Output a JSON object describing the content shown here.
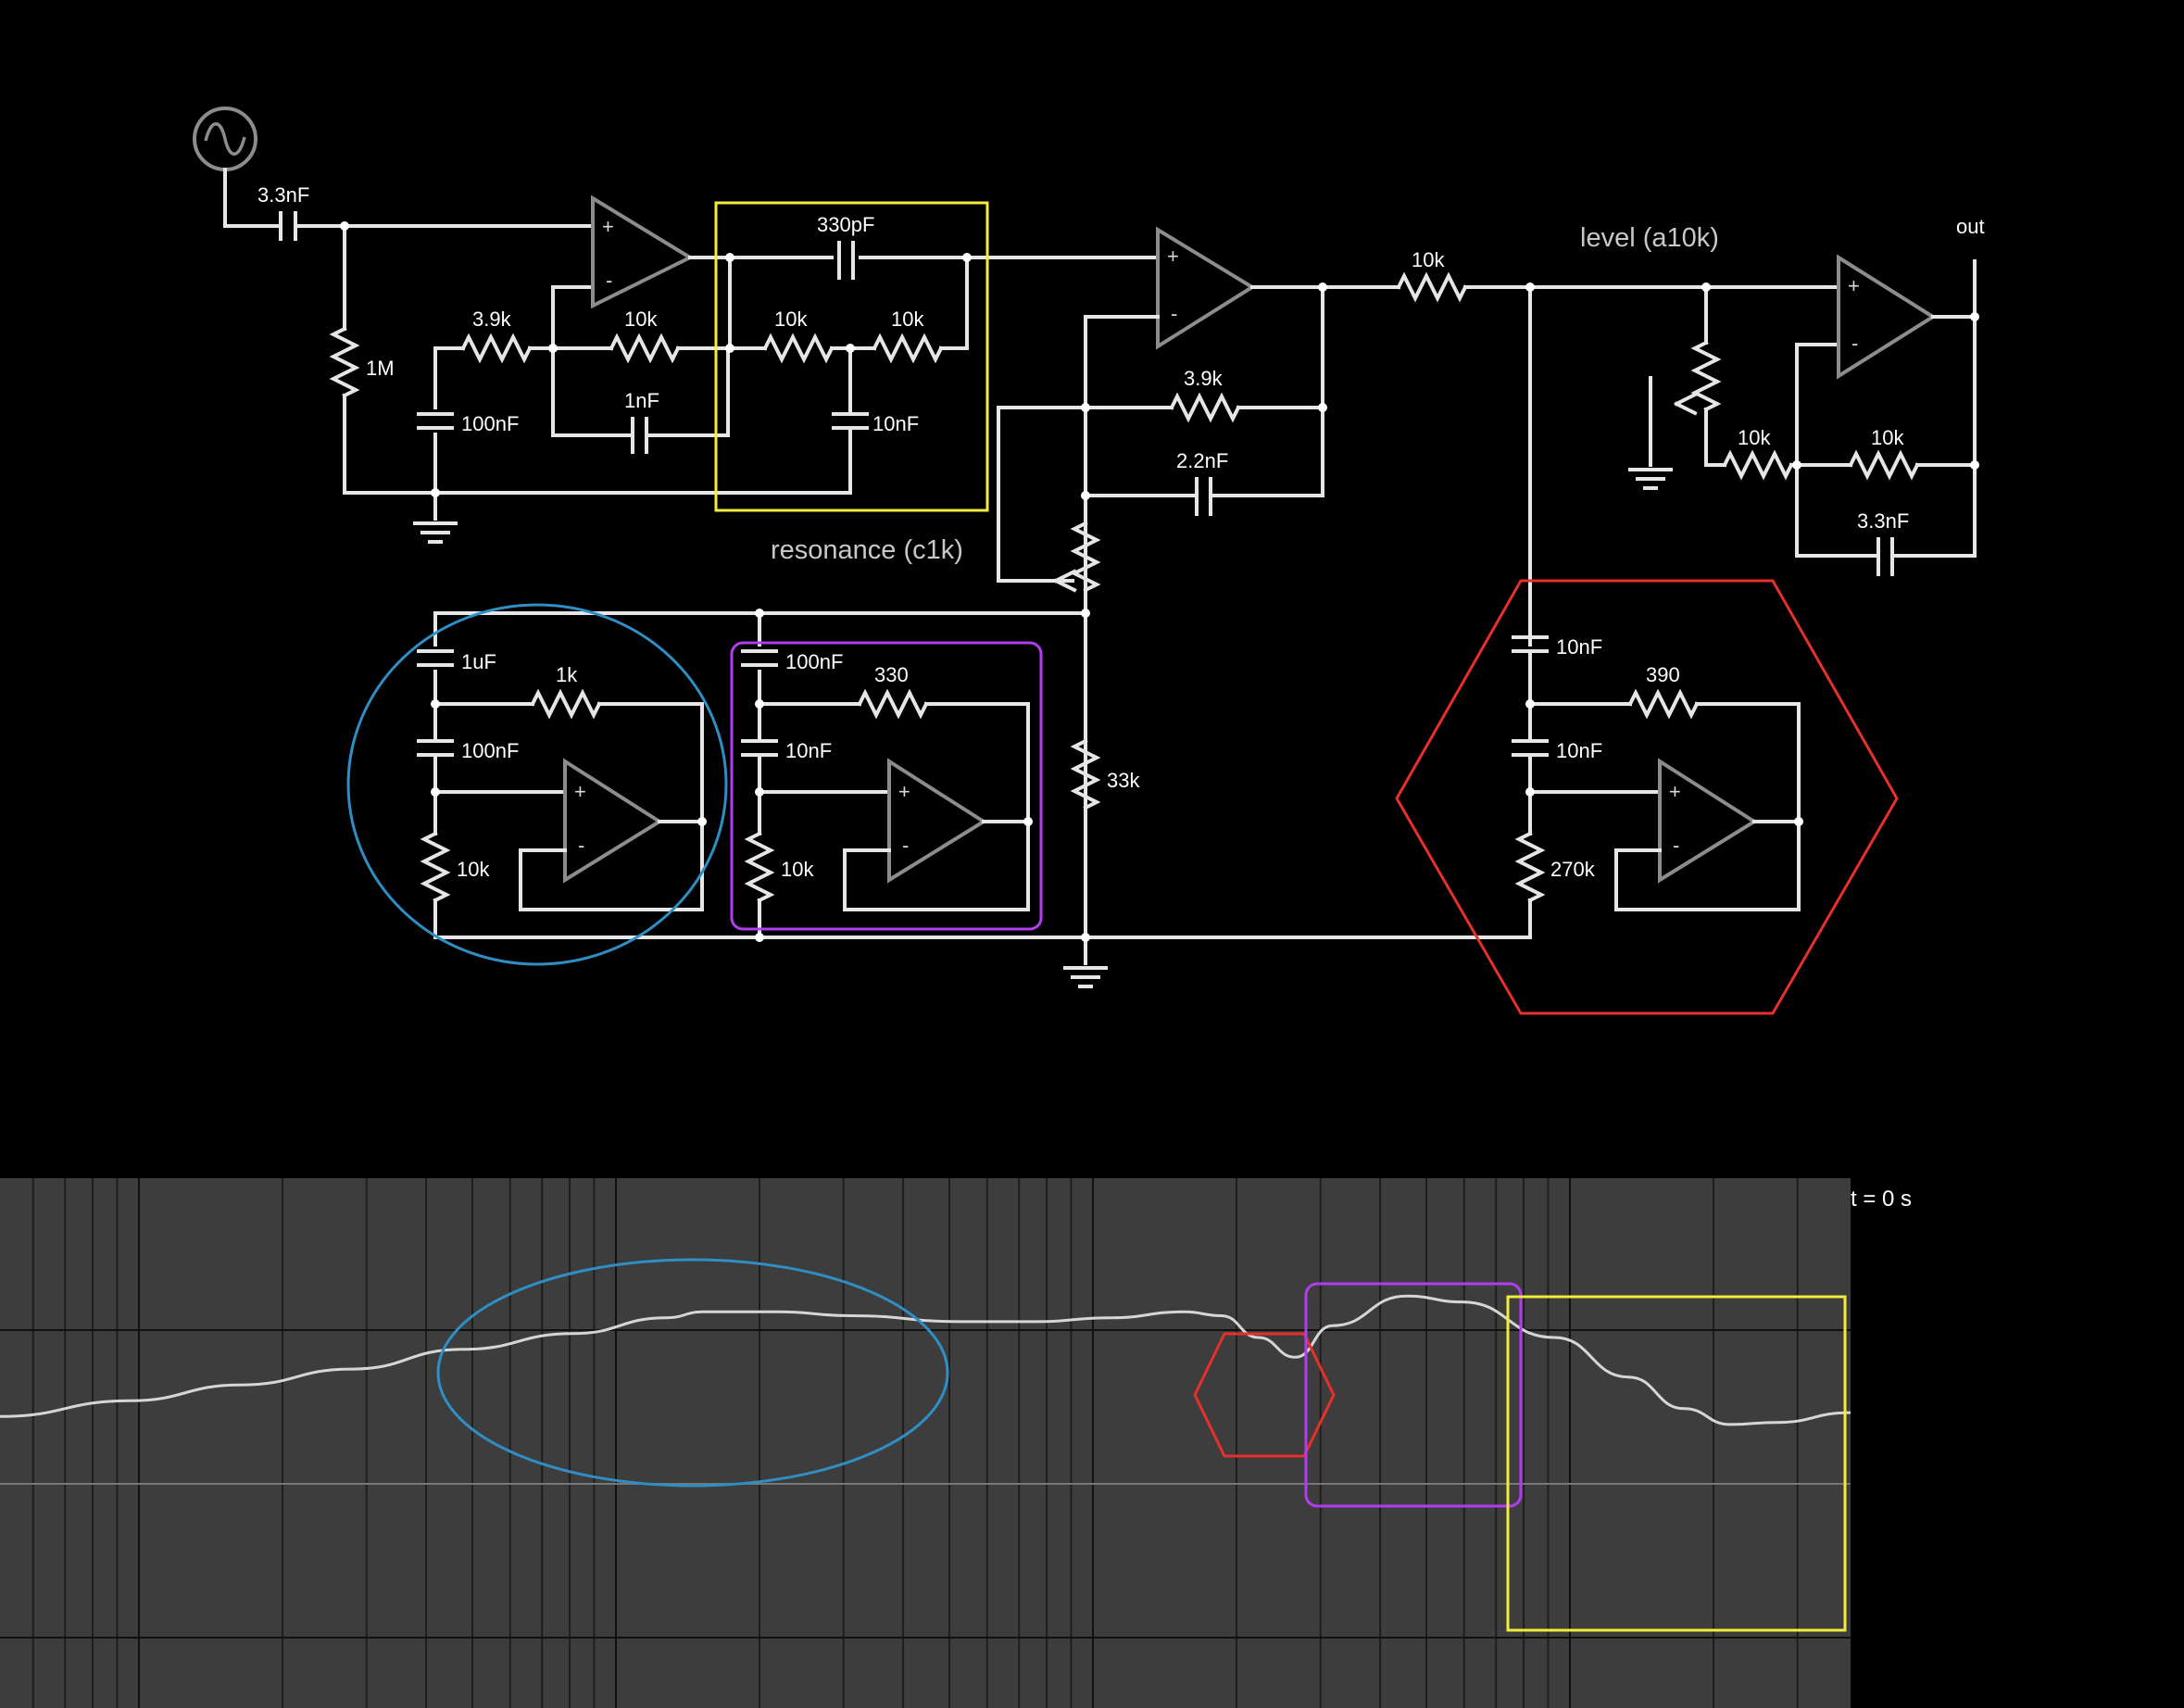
{
  "labels": {
    "c_in": "3.3nF",
    "r_1m": "1M",
    "r_3k9_a": "3.9k",
    "r_10k_a": "10k",
    "c_100nf_a": "100nF",
    "c_1nf": "1nF",
    "c_330pf": "330pF",
    "r_10k_b": "10k",
    "r_10k_c": "10k",
    "c_10nf_a": "10nF",
    "r_3k9_b": "3.9k",
    "c_2n2": "2.2nF",
    "resonance": "resonance (c1k)",
    "r_33k": "33k",
    "r_10k_out": "10k",
    "level": "level (a10k)",
    "out": "out",
    "r_10k_d": "10k",
    "r_10k_e": "10k",
    "c_3n3_b": "3.3nF",
    "c_1uf": "1uF",
    "r_1k": "1k",
    "c_100nf_b": "100nF",
    "r_10k_f": "10k",
    "c_100nf_c": "100nF",
    "r_330": "330",
    "c_10nf_b": "10nF",
    "r_10k_g": "10k",
    "c_10nf_c": "10nF",
    "r_390": "390",
    "c_10nf_d": "10nF",
    "r_270k": "270k",
    "time": "t = 0 s"
  },
  "highlight_colors": {
    "blue": "#2f8ec4",
    "purple": "#b23df0",
    "red": "#e8302a",
    "yellow": "#f3ec3a"
  },
  "scope": {
    "background": "#3d3d3d",
    "curve_color": "#d6d6d6",
    "curve_points": [
      [
        0,
        0.4
      ],
      [
        0.07,
        0.44
      ],
      [
        0.13,
        0.48
      ],
      [
        0.19,
        0.52
      ],
      [
        0.25,
        0.57
      ],
      [
        0.31,
        0.61
      ],
      [
        0.36,
        0.65
      ],
      [
        0.38,
        0.665
      ],
      [
        0.42,
        0.665
      ],
      [
        0.46,
        0.655
      ],
      [
        0.52,
        0.64
      ],
      [
        0.56,
        0.64
      ],
      [
        0.6,
        0.65
      ],
      [
        0.64,
        0.665
      ],
      [
        0.66,
        0.655
      ],
      [
        0.68,
        0.6
      ],
      [
        0.7,
        0.55
      ],
      [
        0.72,
        0.63
      ],
      [
        0.76,
        0.705
      ],
      [
        0.79,
        0.69
      ],
      [
        0.84,
        0.6
      ],
      [
        0.88,
        0.5
      ],
      [
        0.91,
        0.42
      ],
      [
        0.935,
        0.38
      ],
      [
        0.96,
        0.385
      ],
      [
        1.0,
        0.41
      ]
    ]
  }
}
